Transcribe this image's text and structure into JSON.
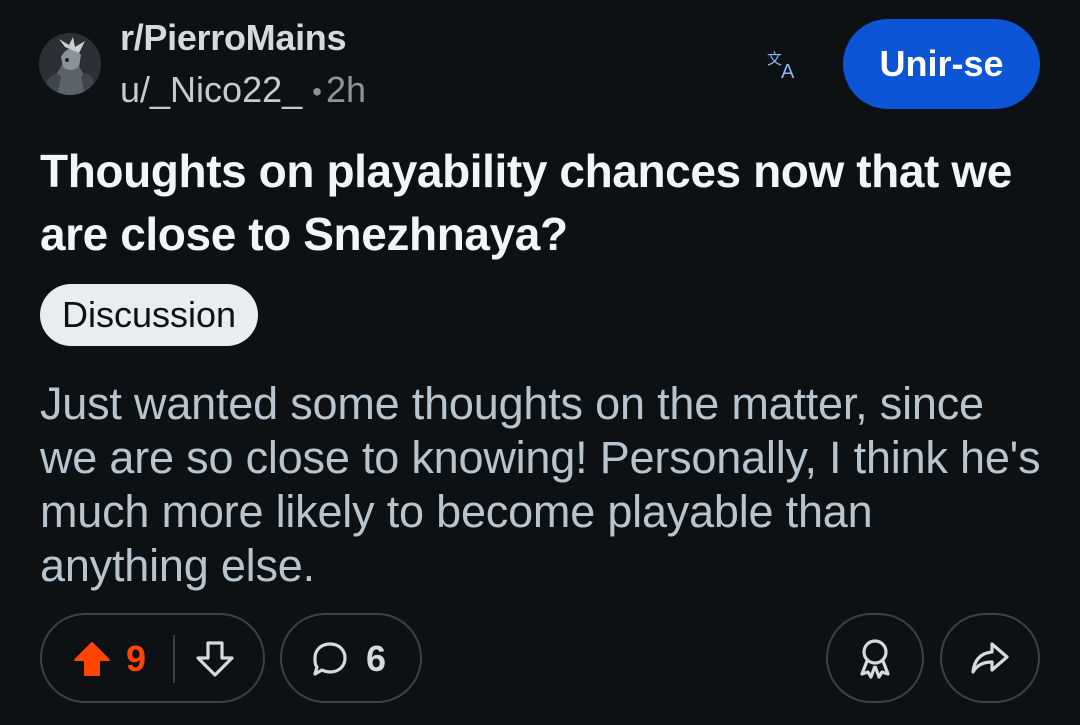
{
  "post": {
    "subreddit": "r/PierroMains",
    "author": "u/_Nico22_",
    "separator": "•",
    "age": "2h",
    "title": "Thoughts on playability chances now that we are close to Snezhnaya?",
    "flair": "Discussion",
    "body": "Just wanted some thoughts on the matter, since we are so close to knowing! Personally, I think he's much more likely to become playable than anything else."
  },
  "header": {
    "join_label": "Unir-se",
    "translate_icon": "translate-icon",
    "avatar_icon": "subreddit-avatar"
  },
  "actions": {
    "score": "9",
    "comments": "6",
    "upvote_icon": "upvote-arrow-icon",
    "downvote_icon": "downvote-arrow-icon",
    "comment_icon": "comment-bubble-icon",
    "award_icon": "award-icon",
    "share_icon": "share-arrow-icon"
  },
  "colors": {
    "background": "#0e1113",
    "accent_blue": "#0b55d6",
    "upvote_orange": "#ff4500",
    "translate_blue": "#8fb2f5"
  }
}
